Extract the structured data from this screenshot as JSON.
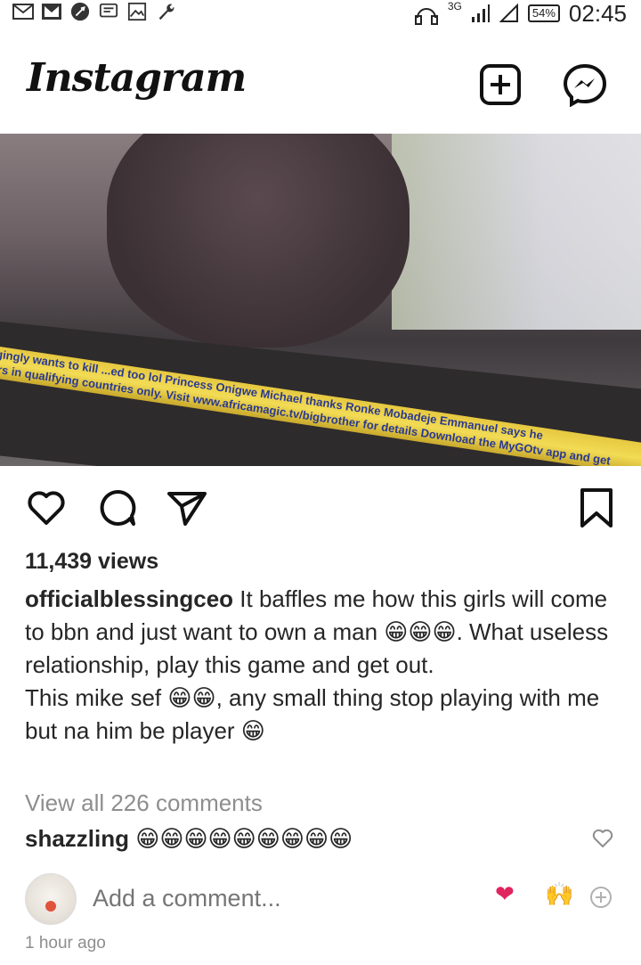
{
  "status_bar": {
    "left_icons": [
      "gmail-icon",
      "gmail-icon",
      "dashlane-icon",
      "message-icon",
      "image-icon",
      "wrench-icon"
    ],
    "network": "3G",
    "battery": "54%",
    "time": "02:45"
  },
  "header": {
    "logo": "Instagram",
    "new_post_icon": "plus-square-icon",
    "messenger_icon": "messenger-icon"
  },
  "media": {
    "ticker_line1": "...gingly wants to kill ...ed too lol  Princess Onigwe Michael thanks  Ronke Mobadeje Emmanuel says he",
    "ticker_line2": "bers in qualifying countries only. Visit www.africamagic.tv/bigbrother for details  Download the MyGOtv app and get"
  },
  "actions": {
    "like_icon": "heart-icon",
    "comment_icon": "comment-icon",
    "share_icon": "send-icon",
    "save_icon": "bookmark-icon"
  },
  "post": {
    "views": "11,439 views",
    "username": "officialblessingceo",
    "caption": " It baffles me how this girls will come to bbn and just want to own a man 😁😁😁. What useless relationship, play this game and get out.\nThis mike sef 😁😁, any small thing stop playing with me but na him be player 😁",
    "view_all_comments": "View all 226 comments",
    "timestamp": "1 hour ago"
  },
  "comments": [
    {
      "username": "shazzling",
      "text": " 😁😁😁😁😁😁😁😁😁"
    }
  ],
  "add_comment": {
    "placeholder": "Add a comment...",
    "quick_reactions": [
      "❤",
      "🙌"
    ]
  }
}
